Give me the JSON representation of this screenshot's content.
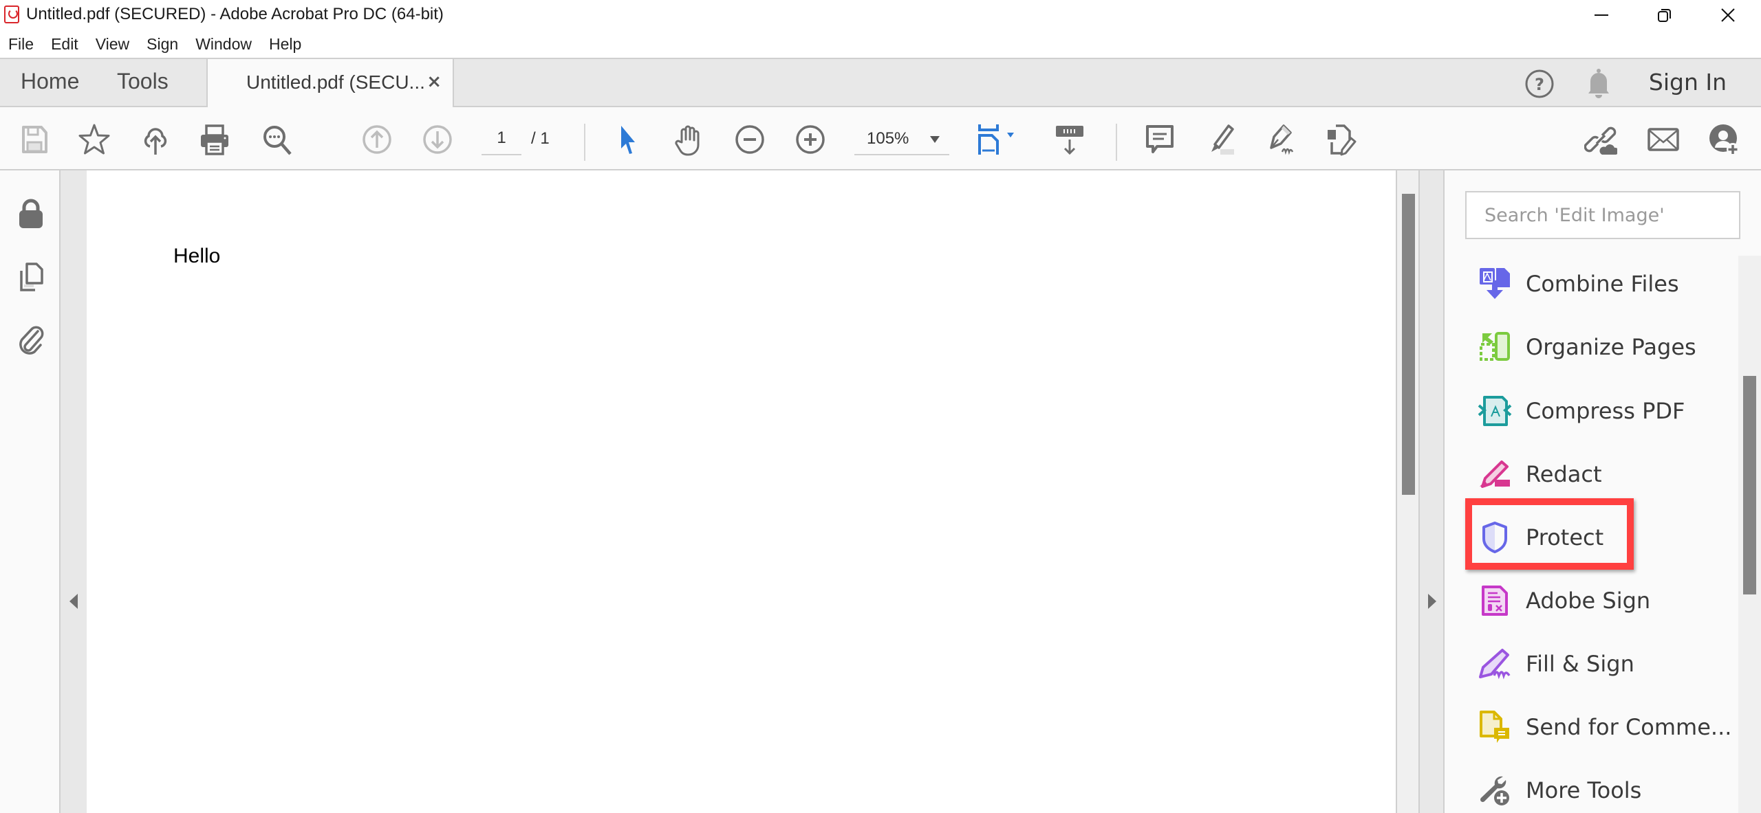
{
  "window": {
    "title": "Untitled.pdf (SECURED) - Adobe Acrobat Pro DC (64-bit)",
    "app_icon": "acrobat-pdf-icon",
    "controls": [
      "minimize",
      "restore",
      "close"
    ]
  },
  "menubar": {
    "items": [
      "File",
      "Edit",
      "View",
      "Sign",
      "Window",
      "Help"
    ]
  },
  "tabs": {
    "home": "Home",
    "tools": "Tools",
    "document_tab": "Untitled.pdf (SECU...",
    "close_glyph": "×",
    "sign_in": "Sign In",
    "help_icon": "help-circle-icon",
    "notifications_icon": "bell-icon"
  },
  "toolbar": {
    "left_icons": [
      "save-icon",
      "bookmark-star-icon",
      "cloud-upload-icon",
      "print-icon",
      "find-icon"
    ],
    "page_nav": {
      "prev_icon": "page-up-icon",
      "next_icon": "page-down-icon",
      "current_page": "1",
      "total_pages": "/ 1"
    },
    "view_tools": [
      "select-cursor-icon",
      "hand-tool-icon",
      "zoom-out-icon",
      "zoom-in-icon"
    ],
    "zoom_level": "105%",
    "layout_tools": [
      "fit-page-icon",
      "scrolling-mode-icon"
    ],
    "annotate_tools": [
      "comment-icon",
      "highlight-icon",
      "sign-pen-icon",
      "edit-pdf-icon"
    ],
    "right_icons": [
      "share-link-icon",
      "email-icon",
      "add-user-icon"
    ]
  },
  "left_panel": {
    "icons": [
      "lock-icon",
      "page-thumbnails-icon",
      "attachments-icon"
    ]
  },
  "document": {
    "text": "Hello"
  },
  "tools_panel": {
    "search_placeholder": "Search 'Edit Image'",
    "search_value": "",
    "items": [
      {
        "label": "Combine Files",
        "icon": "combine-files-icon",
        "color": "#6767e8"
      },
      {
        "label": "Organize Pages",
        "icon": "organize-pages-icon",
        "color": "#7ccb3f"
      },
      {
        "label": "Compress PDF",
        "icon": "compress-pdf-icon",
        "color": "#1c9c9c"
      },
      {
        "label": "Redact",
        "icon": "redact-icon",
        "color": "#d83790"
      },
      {
        "label": "Protect",
        "icon": "protect-shield-icon",
        "color": "#6767e8"
      },
      {
        "label": "Adobe Sign",
        "icon": "adobe-sign-icon",
        "color": "#c638c8"
      },
      {
        "label": "Fill & Sign",
        "icon": "fill-sign-icon",
        "color": "#9a55e0"
      },
      {
        "label": "Send for Comme...",
        "icon": "send-for-comment-icon",
        "color": "#dbb800"
      },
      {
        "label": "More Tools",
        "icon": "more-tools-icon",
        "color": "#6e6e6e"
      }
    ],
    "highlighted_item": "Protect",
    "highlight_color": "#ff4040"
  }
}
